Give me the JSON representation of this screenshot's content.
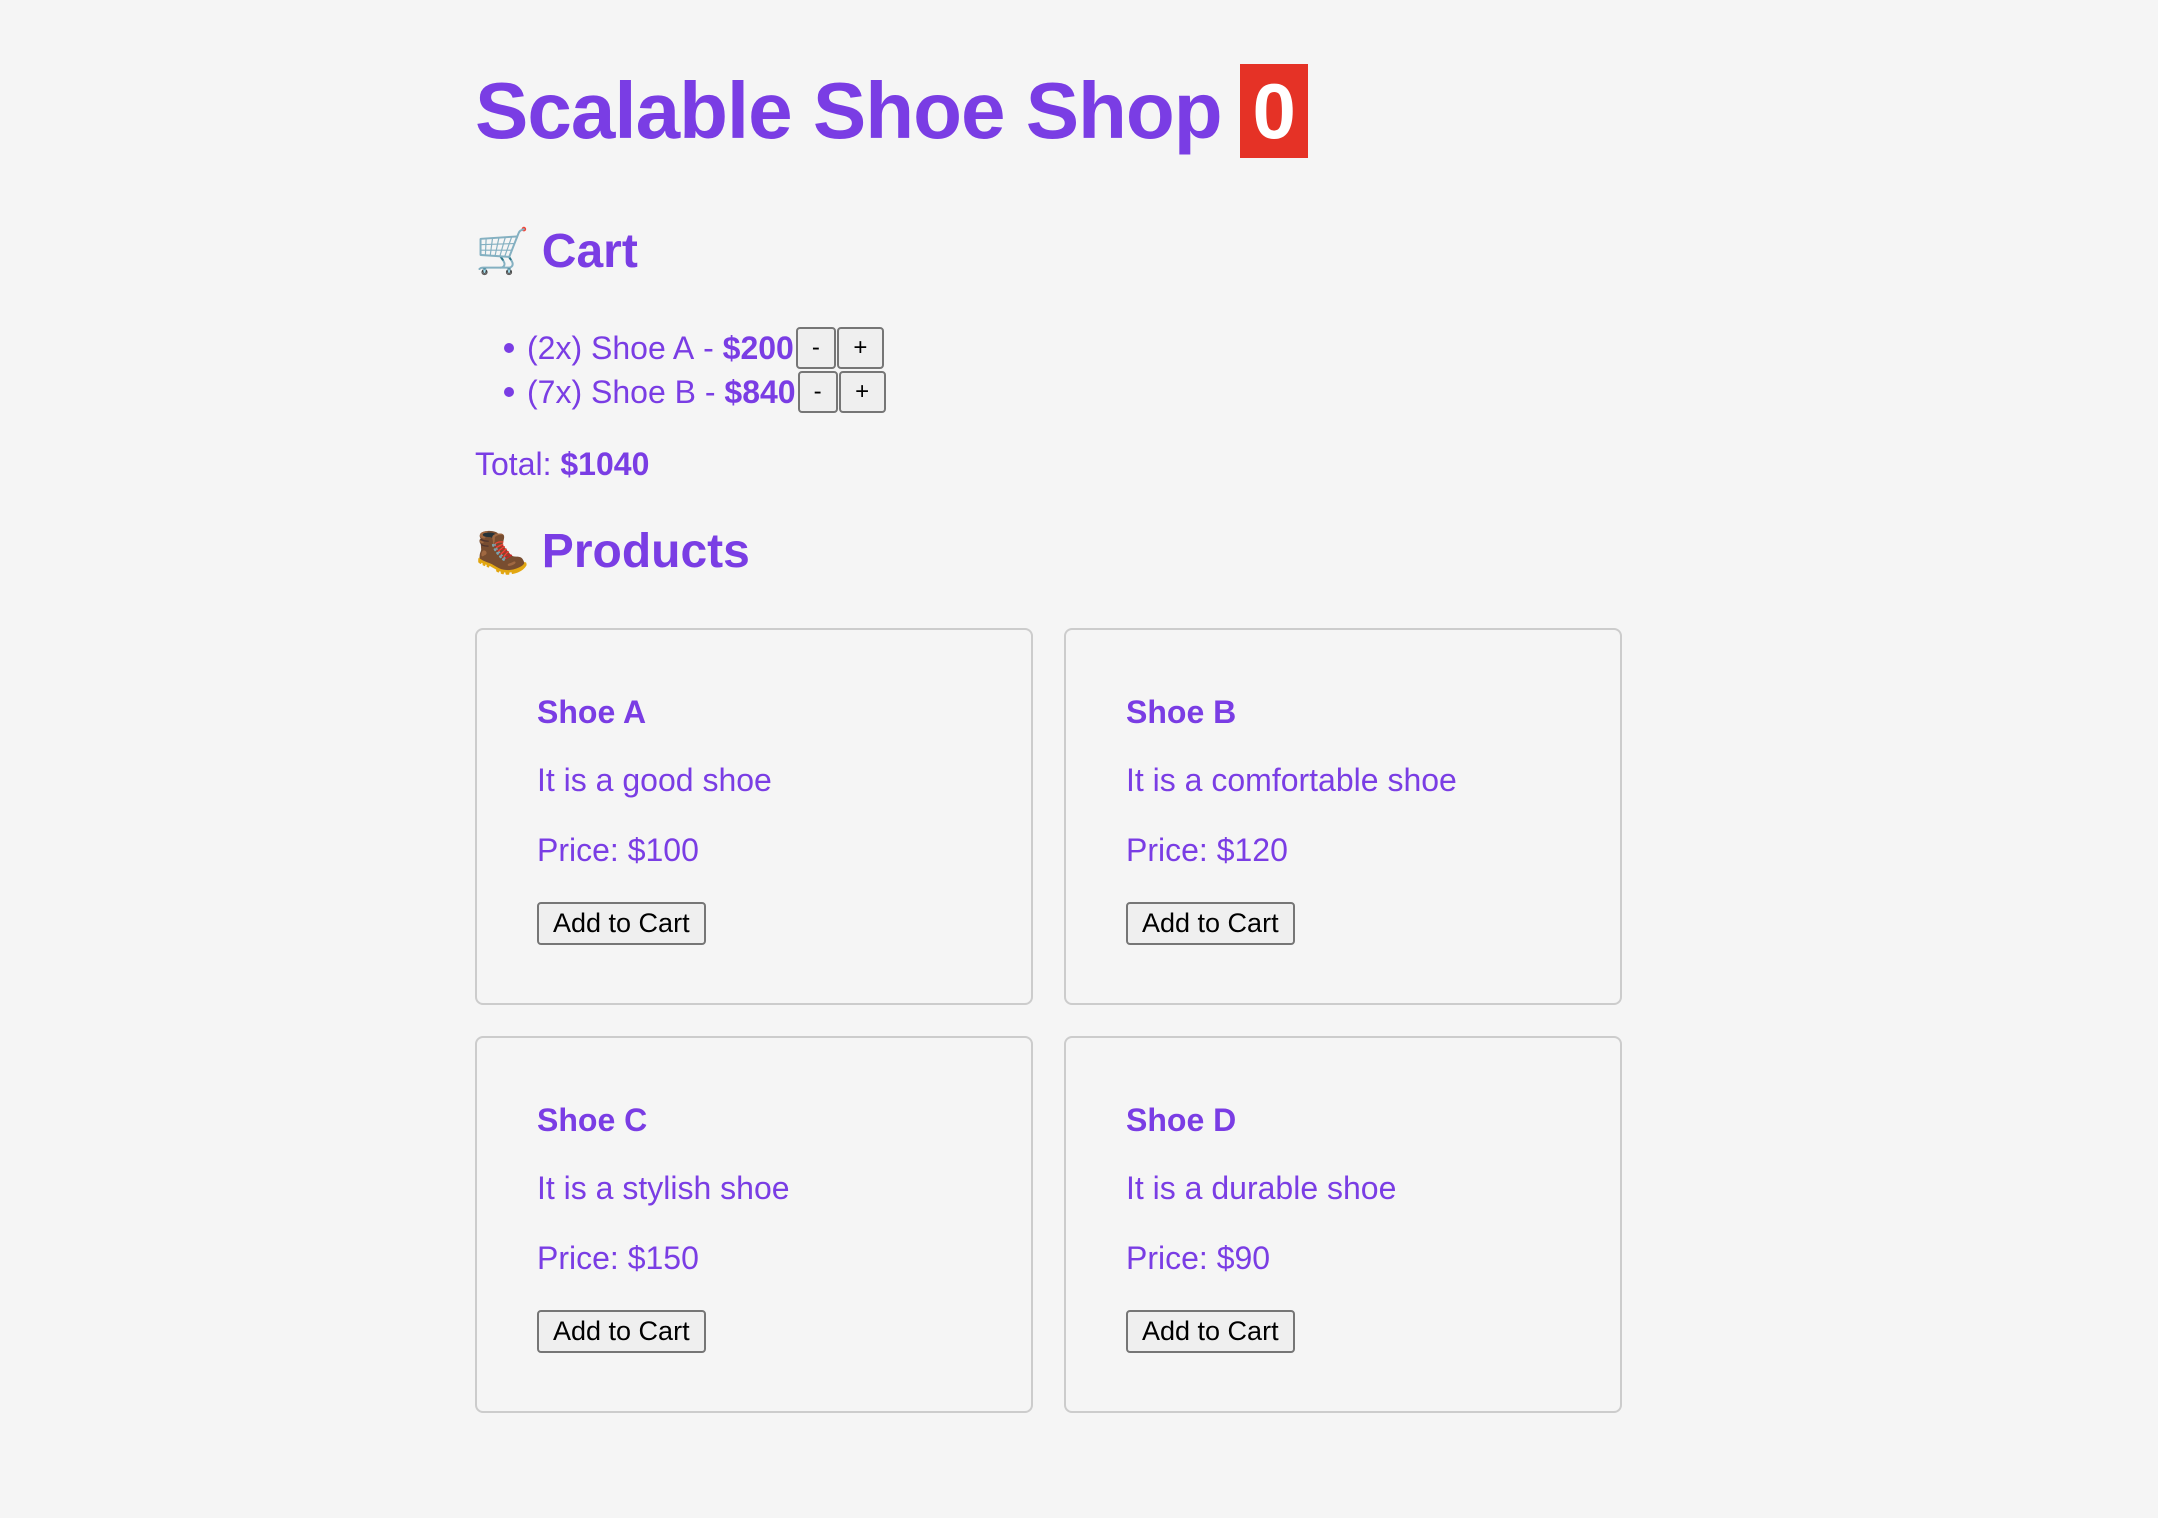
{
  "header": {
    "title": "Scalable Shoe Shop",
    "badge_count": "0"
  },
  "colors": {
    "accent": "#7a3de4",
    "badge": "#e53226",
    "background": "#f5f5f5"
  },
  "cart": {
    "icon": "shopping-cart-icon",
    "emoji": "🛒",
    "heading": "Cart",
    "items": [
      {
        "qty_label": "(2x)",
        "name": "Shoe A",
        "sep": "-",
        "subtotal": "$200",
        "minus_label": "-",
        "plus_label": "+"
      },
      {
        "qty_label": "(7x)",
        "name": "Shoe B",
        "sep": "-",
        "subtotal": "$840",
        "minus_label": "-",
        "plus_label": "+"
      }
    ],
    "total_label": "Total:",
    "total_value": "$1040"
  },
  "products": {
    "icon": "hiking-boot-icon",
    "emoji": "🥾",
    "heading": "Products",
    "items": [
      {
        "name": "Shoe A",
        "description": "It is a good shoe",
        "price": "Price: $100",
        "button": "Add to Cart"
      },
      {
        "name": "Shoe B",
        "description": "It is a comfortable shoe",
        "price": "Price: $120",
        "button": "Add to Cart"
      },
      {
        "name": "Shoe C",
        "description": "It is a stylish shoe",
        "price": "Price: $150",
        "button": "Add to Cart"
      },
      {
        "name": "Shoe D",
        "description": "It is a durable shoe",
        "price": "Price: $90",
        "button": "Add to Cart"
      }
    ]
  }
}
